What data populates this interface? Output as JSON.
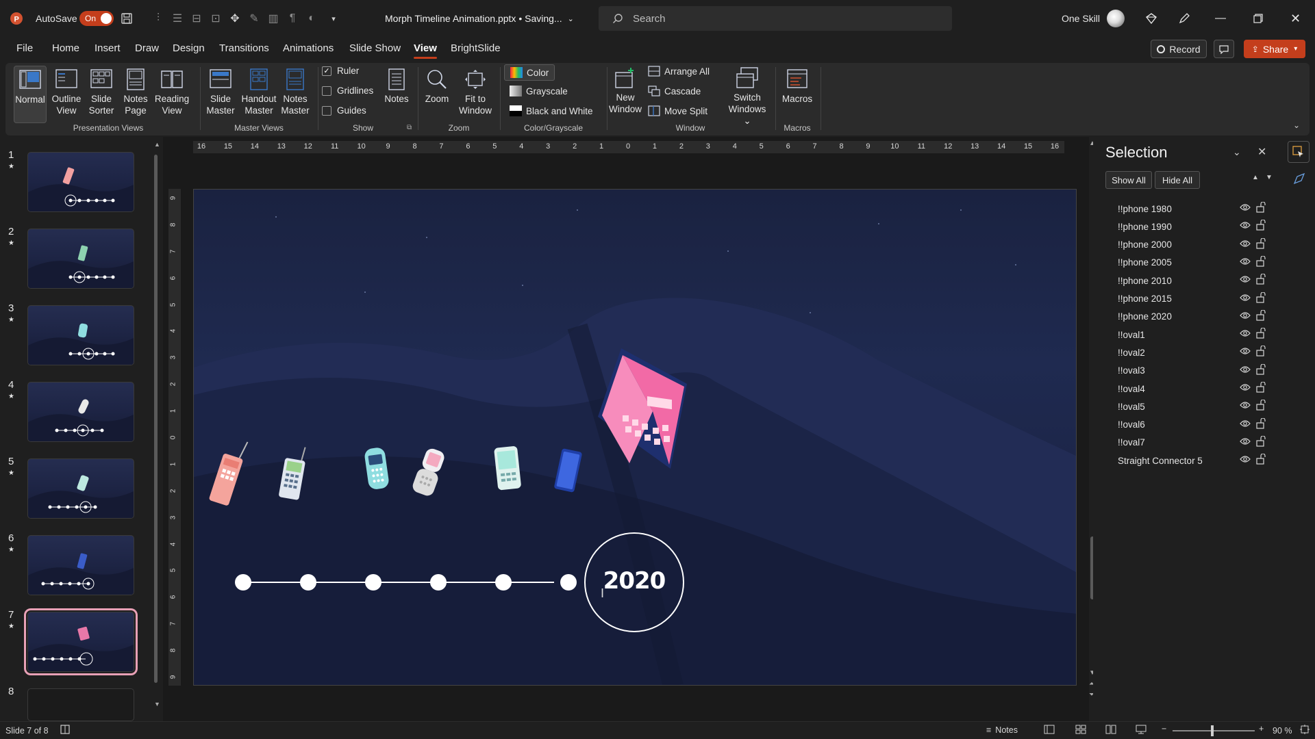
{
  "titlebar": {
    "autosave_label": "AutoSave",
    "autosave_state": "On",
    "document_title": "Morph Timeline Animation.pptx • Saving...",
    "search_placeholder": "Search",
    "user_name": "One Skill"
  },
  "menu": {
    "tabs": [
      "File",
      "Home",
      "Insert",
      "Draw",
      "Design",
      "Transitions",
      "Animations",
      "Slide Show",
      "View",
      "BrightSlide"
    ],
    "active": "View",
    "record_label": "Record",
    "share_label": "Share"
  },
  "ribbon": {
    "presentation_views": {
      "label": "Presentation Views",
      "buttons": [
        {
          "line1": "Normal",
          "line2": ""
        },
        {
          "line1": "Outline",
          "line2": "View"
        },
        {
          "line1": "Slide",
          "line2": "Sorter"
        },
        {
          "line1": "Notes",
          "line2": "Page"
        },
        {
          "line1": "Reading",
          "line2": "View"
        }
      ]
    },
    "master_views": {
      "label": "Master Views",
      "buttons": [
        {
          "line1": "Slide",
          "line2": "Master"
        },
        {
          "line1": "Handout",
          "line2": "Master"
        },
        {
          "line1": "Notes",
          "line2": "Master"
        }
      ]
    },
    "show": {
      "label": "Show",
      "ruler": "Ruler",
      "gridlines": "Gridlines",
      "guides": "Guides",
      "notes": "Notes"
    },
    "zoom": {
      "label": "Zoom",
      "zoom_btn": "Zoom",
      "fit_line1": "Fit to",
      "fit_line2": "Window"
    },
    "color_grayscale": {
      "label": "Color/Grayscale",
      "color": "Color",
      "grayscale": "Grayscale",
      "bw": "Black and White"
    },
    "window": {
      "label": "Window",
      "new_line1": "New",
      "new_line2": "Window",
      "arrange_all": "Arrange All",
      "cascade": "Cascade",
      "move_split": "Move Split",
      "switch_line1": "Switch",
      "switch_line2": "Windows"
    },
    "macros": {
      "label": "Macros",
      "btn": "Macros"
    }
  },
  "thumbnails": [
    {
      "num": "1",
      "star": "★"
    },
    {
      "num": "2",
      "star": "★"
    },
    {
      "num": "3",
      "star": "★"
    },
    {
      "num": "4",
      "star": "★"
    },
    {
      "num": "5",
      "star": "★"
    },
    {
      "num": "6",
      "star": "★"
    },
    {
      "num": "7",
      "star": "★"
    },
    {
      "num": "8",
      "star": ""
    }
  ],
  "ruler": {
    "horizontal": [
      "16",
      "15",
      "14",
      "13",
      "12",
      "11",
      "10",
      "9",
      "8",
      "7",
      "6",
      "5",
      "4",
      "3",
      "2",
      "1",
      "0",
      "1",
      "2",
      "3",
      "4",
      "5",
      "6",
      "7",
      "8",
      "9",
      "10",
      "11",
      "12",
      "13",
      "14",
      "15",
      "16"
    ],
    "vertical": [
      "9",
      "8",
      "7",
      "6",
      "5",
      "4",
      "3",
      "2",
      "1",
      "0",
      "1",
      "2",
      "3",
      "4",
      "5",
      "6",
      "7",
      "8",
      "9"
    ]
  },
  "slide": {
    "year_label": "2020"
  },
  "selection_pane": {
    "title": "Selection",
    "show_all": "Show All",
    "hide_all": "Hide All",
    "items": [
      "!!phone 1980",
      "!!phone 1990",
      "!!phone 2000",
      "!!phone 2005",
      "!!phone 2010",
      "!!phone 2015",
      "!!phone 2020",
      "!!oval1",
      "!!oval2",
      "!!oval3",
      "!!oval4",
      "!!oval5",
      "!!oval6",
      "!!oval7",
      "Straight Connector 5"
    ]
  },
  "status": {
    "slide_info": "Slide 7 of 8",
    "notes": "Notes",
    "zoom": "90 %"
  }
}
